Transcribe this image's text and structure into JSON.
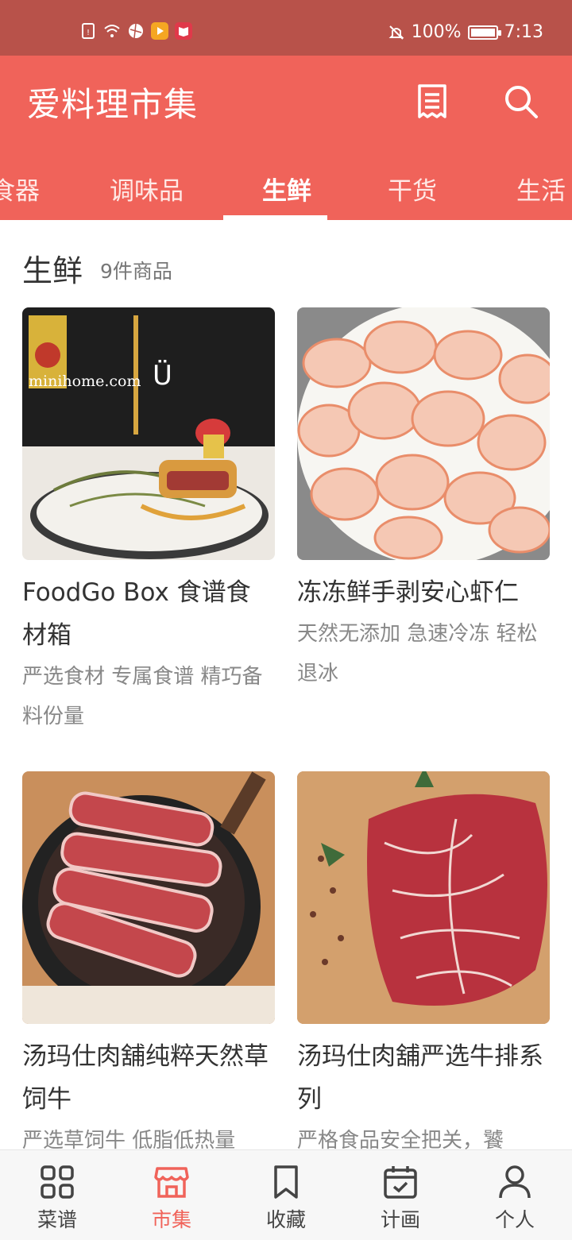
{
  "status_bar": {
    "battery": "100%",
    "time": "7:13",
    "battery_level": 1.0
  },
  "app": {
    "title": "爱料理市集"
  },
  "tabs": [
    {
      "label": "食器"
    },
    {
      "label": "调味品"
    },
    {
      "label": "生鲜"
    },
    {
      "label": "干货"
    },
    {
      "label": "生活"
    }
  ],
  "active_tab": "生鲜",
  "section": {
    "title": "生鲜",
    "count": "9件商品"
  },
  "products": [
    {
      "name": "FoodGo Box 食谱食材箱",
      "desc": "严选食材 专属食谱 精巧备料份量",
      "image_text": "minihome.com",
      "image_badge": "Ü"
    },
    {
      "name": "冻冻鲜手剥安心虾仁",
      "desc": "天然无添加 急速冷冻 轻松退冰"
    },
    {
      "name": "汤玛仕肉舖纯粹天然草饲牛",
      "desc": "严选草饲牛 低脂低热量"
    },
    {
      "name": "汤玛仕肉舖严选牛排系列",
      "desc": "严格食品安全把关，饕"
    }
  ],
  "bottom_nav": [
    {
      "label": "菜谱",
      "icon": "grid-icon"
    },
    {
      "label": "市集",
      "icon": "shop-icon"
    },
    {
      "label": "收藏",
      "icon": "bookmark-icon"
    },
    {
      "label": "计画",
      "icon": "calendar-icon"
    },
    {
      "label": "个人",
      "icon": "person-icon"
    }
  ],
  "colors": {
    "primary": "#f0635a",
    "status_bar": "#b8524a",
    "text": "#333333",
    "muted": "#888888"
  }
}
